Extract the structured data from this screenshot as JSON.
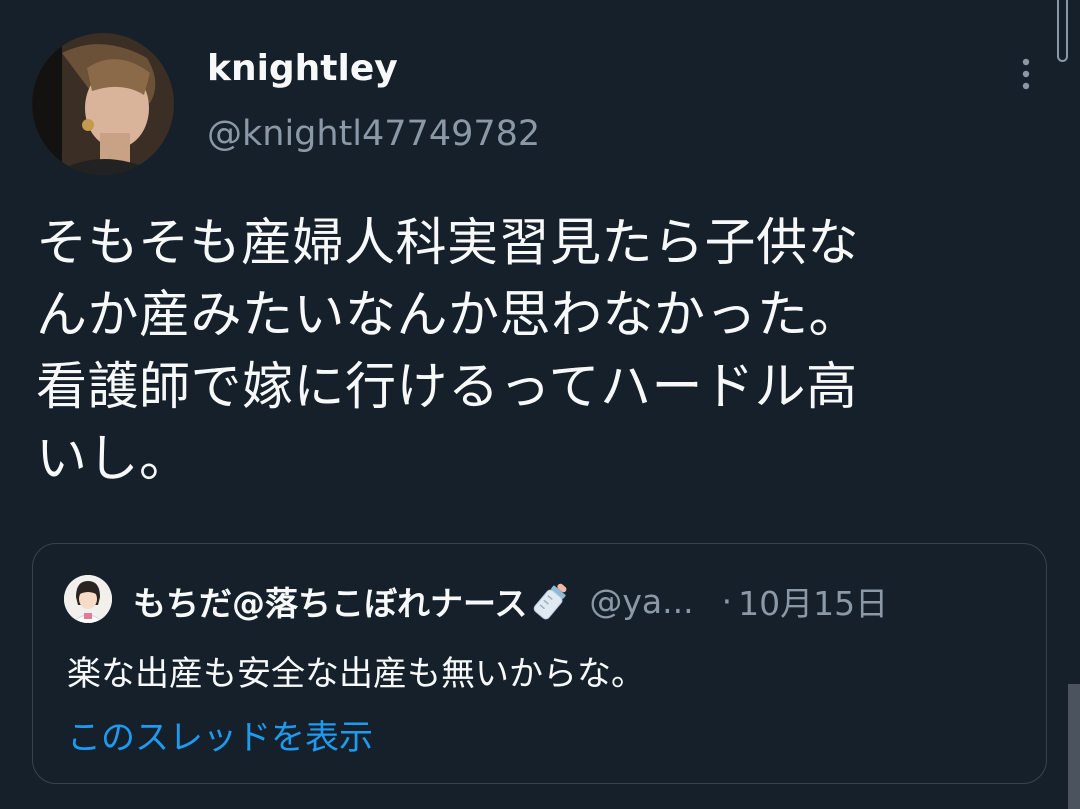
{
  "tweet": {
    "author": {
      "display_name": "knightley",
      "handle": "@knightl47749782",
      "avatar_icon": "profile-photo"
    },
    "more_icon": "more-vertical-icon",
    "text_lines": [
      "そもそも産婦人科実習見たら子供な",
      "んか産みたいなんか思わなかった。",
      "看護師で嫁に行けるってハードル高",
      "いし。"
    ]
  },
  "quoted_tweet": {
    "display_name": "もちだ@落ちこぼれナース",
    "name_emoji": "baby-bottle-icon",
    "handle": "@ya...",
    "separator": "·",
    "date": "10月15日",
    "text": "楽な出産も安全な出産も無いからな。",
    "show_thread_label": "このスレッドを表示"
  },
  "colors": {
    "background": "#15202b",
    "text_primary": "#f7f9f9",
    "text_secondary": "#8b98a5",
    "accent_link": "#1d9bf0",
    "border": "#38444d"
  }
}
